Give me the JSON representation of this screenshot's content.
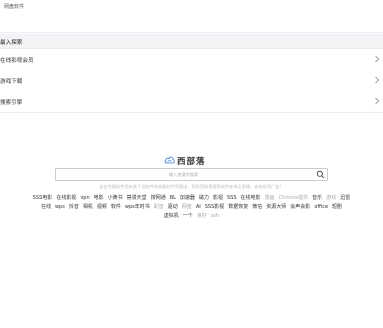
{
  "page": {
    "breadcrumb": "网盘软件"
  },
  "menu": {
    "header": "最入探索",
    "items": [
      {
        "label": "在线影视会员"
      },
      {
        "label": "游戏下载"
      },
      {
        "label": "搜索引擎"
      }
    ]
  },
  "site": {
    "logo_text": "西部落",
    "search_placeholder": "输入关键字搜索",
    "notice": "这台为搜软件而安装下设软件前收搜软件而我出，您用西部落搜索软件安卓全家桶，安装应用广告！"
  },
  "tags": [
    {
      "label": "SSS电影",
      "dim": false
    },
    {
      "label": "在线影视",
      "dim": false
    },
    {
      "label": "vpn",
      "dim": false
    },
    {
      "label": "电影",
      "dim": false
    },
    {
      "label": "小黄书",
      "dim": false
    },
    {
      "label": "禁漫天堂",
      "dim": false
    },
    {
      "label": "搜网通",
      "dim": false
    },
    {
      "label": "BL",
      "dim": false
    },
    {
      "label": "加速器",
      "dim": false
    },
    {
      "label": "磁力",
      "dim": false
    },
    {
      "label": "影视",
      "dim": false
    },
    {
      "label": "SSS",
      "dim": false
    },
    {
      "label": "在线电影",
      "dim": false
    },
    {
      "label": "漫画",
      "dim": true
    },
    {
      "label": "Chrome插件",
      "dim": true
    },
    {
      "label": "音乐",
      "dim": false
    },
    {
      "label": "游戏",
      "dim": true
    },
    {
      "label": "迅雷",
      "dim": false
    },
    {
      "label": "在线",
      "dim": false
    },
    {
      "label": "wps",
      "dim": false
    },
    {
      "label": "抖音",
      "dim": false
    },
    {
      "label": "相机",
      "dim": false
    },
    {
      "label": "视频",
      "dim": false
    },
    {
      "label": "软件",
      "dim": false
    },
    {
      "label": "wps年时书",
      "dim": false
    },
    {
      "label": "配音",
      "dim": true
    },
    {
      "label": "驱动",
      "dim": false
    },
    {
      "label": "网盘",
      "dim": true
    },
    {
      "label": "AI",
      "dim": false
    },
    {
      "label": "SSS影视",
      "dim": false
    },
    {
      "label": "数据恢复",
      "dim": false
    },
    {
      "label": "微信",
      "dim": false
    },
    {
      "label": "资源大师",
      "dim": false
    },
    {
      "label": "会声会影",
      "dim": false
    },
    {
      "label": "office",
      "dim": false
    },
    {
      "label": "短剧",
      "dim": false
    },
    {
      "label": "虚拟机",
      "dim": false
    },
    {
      "label": "一个",
      "dim": false
    },
    {
      "label": "良好",
      "dim": true
    },
    {
      "label": "ssh",
      "dim": true
    }
  ],
  "colors": {
    "menu_header_bg": "#f2f3f5",
    "text_main": "#333333",
    "text_dim": "#aaaaaa",
    "logo_icon": "#3a7bd5"
  }
}
